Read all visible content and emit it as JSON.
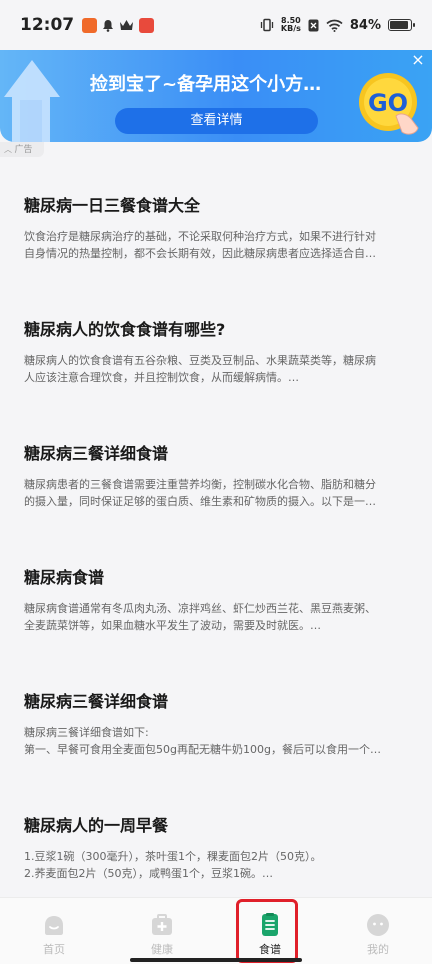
{
  "status_bar": {
    "time": "12:07",
    "net_speed_value": "8.50",
    "net_speed_unit": "KB/s",
    "battery_pct": "84%",
    "battery_level": 0.84
  },
  "ad": {
    "headline": "捡到宝了~备孕用这个小方…",
    "cta": "查看详情",
    "go_text": "GO",
    "tag": "广告",
    "close": "×"
  },
  "articles": [
    {
      "title": "糖尿病一日三餐食谱大全",
      "summary": [
        "饮食治疗是糖尿病治疗的基础，不论采取何种治疗方式，如果不进行针对",
        "自身情况的热量控制，都不会长期有效，因此糖尿病患者应选择适合自…"
      ]
    },
    {
      "title": "糖尿病人的饮食食谱有哪些?",
      "summary": [
        "糖尿病人的饮食食谱有五谷杂粮、豆类及豆制品、水果蔬菜类等，糖尿病",
        "人应该注意合理饮食，并且控制饮食，从而缓解病情。…"
      ]
    },
    {
      "title": "糖尿病三餐详细食谱",
      "summary": [
        "糖尿病患者的三餐食谱需要注重营养均衡，控制碳水化合物、脂肪和糖分",
        "的摄入量，同时保证足够的蛋白质、维生素和矿物质的摄入。以下是一…"
      ]
    },
    {
      "title": "糖尿病食谱",
      "summary": [
        "糖尿病食谱通常有冬瓜肉丸汤、凉拌鸡丝、虾仁炒西兰花、黑豆燕麦粥、",
        "全麦蔬菜饼等，如果血糖水平发生了波动，需要及时就医。…"
      ]
    },
    {
      "title": "糖尿病三餐详细食谱",
      "summary": [
        "糖尿病三餐详细食谱如下:",
        "第一、早餐可食用全麦面包50g再配无糖牛奶100g，餐后可以食用一个…"
      ]
    },
    {
      "title": "糖尿病人的一周早餐",
      "summary": [
        "1.豆浆1碗（300毫升），茶叶蛋1个，稞麦面包2片（50克）。",
        "2.荞麦面包2片（50克），咸鸭蛋1个，豆浆1碗。…"
      ]
    }
  ],
  "nav": {
    "items": [
      {
        "label": "首页",
        "icon": "home-icon",
        "active": false
      },
      {
        "label": "健康",
        "icon": "health-kit-icon",
        "active": false
      },
      {
        "label": "食谱",
        "icon": "recipe-list-icon",
        "active": true
      },
      {
        "label": "我的",
        "icon": "profile-icon",
        "active": false
      }
    ]
  },
  "colors": {
    "accent": "#1aa56b",
    "ad_blue": "#3a8ef6",
    "highlight": "#e0202a"
  }
}
